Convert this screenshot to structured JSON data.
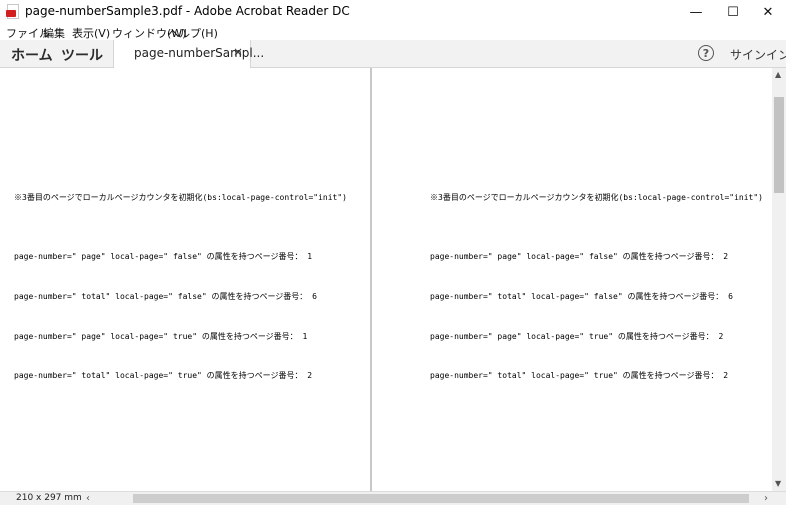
{
  "window": {
    "title": "page-numberSample3.pdf - Adobe Acrobat Reader DC",
    "minimize_glyph": "—",
    "maximize_glyph": "☐",
    "close_glyph": "✕"
  },
  "menu": [
    "ファイル",
    "編集",
    "表示(V)",
    "ウィンドウ(W)",
    "ヘルプ(H)"
  ],
  "tabs": {
    "home": "ホーム",
    "tools": "ツール",
    "document": "page-numberSampl...",
    "close_glyph": "×"
  },
  "header_right": {
    "help_glyph": "?",
    "signin": "サインイン"
  },
  "pages": [
    {
      "heading": "※3番目のページでローカルページカウンタを初期化(bs:local-page-control=\"init\")",
      "lines": [
        "page-number=\" page\" local-page=\" false\" の属性を持つページ番号： 1",
        "page-number=\" total\" local-page=\" false\" の属性を持つページ番号： 6",
        "page-number=\" page\" local-page=\" true\" の属性を持つページ番号： 1",
        "page-number=\" total\" local-page=\" true\" の属性を持つページ番号： 2"
      ]
    },
    {
      "heading": "※3番目のページでローカルページカウンタを初期化(bs:local-page-control=\"init\")",
      "lines": [
        "page-number=\" page\" local-page=\" false\" の属性を持つページ番号： 2",
        "page-number=\" total\" local-page=\" false\" の属性を持つページ番号： 6",
        "page-number=\" page\" local-page=\" true\" の属性を持つページ番号： 2",
        "page-number=\" total\" local-page=\" true\" の属性を持つページ番号： 2"
      ]
    }
  ],
  "status": {
    "page_size": "210 x 297 mm"
  },
  "icons": {
    "app": "acrobat-pdf-icon",
    "help": "help-circle-icon",
    "scroll_up": "triangle-up-icon",
    "scroll_down": "triangle-down-icon",
    "scroll_left": "chevron-left-icon",
    "scroll_right": "chevron-right-icon"
  },
  "colors": {
    "acrobat_red": "#d21f1f",
    "tabbar_bg": "#f2f2f2",
    "scrollbar_bg": "#f0f0f0"
  }
}
